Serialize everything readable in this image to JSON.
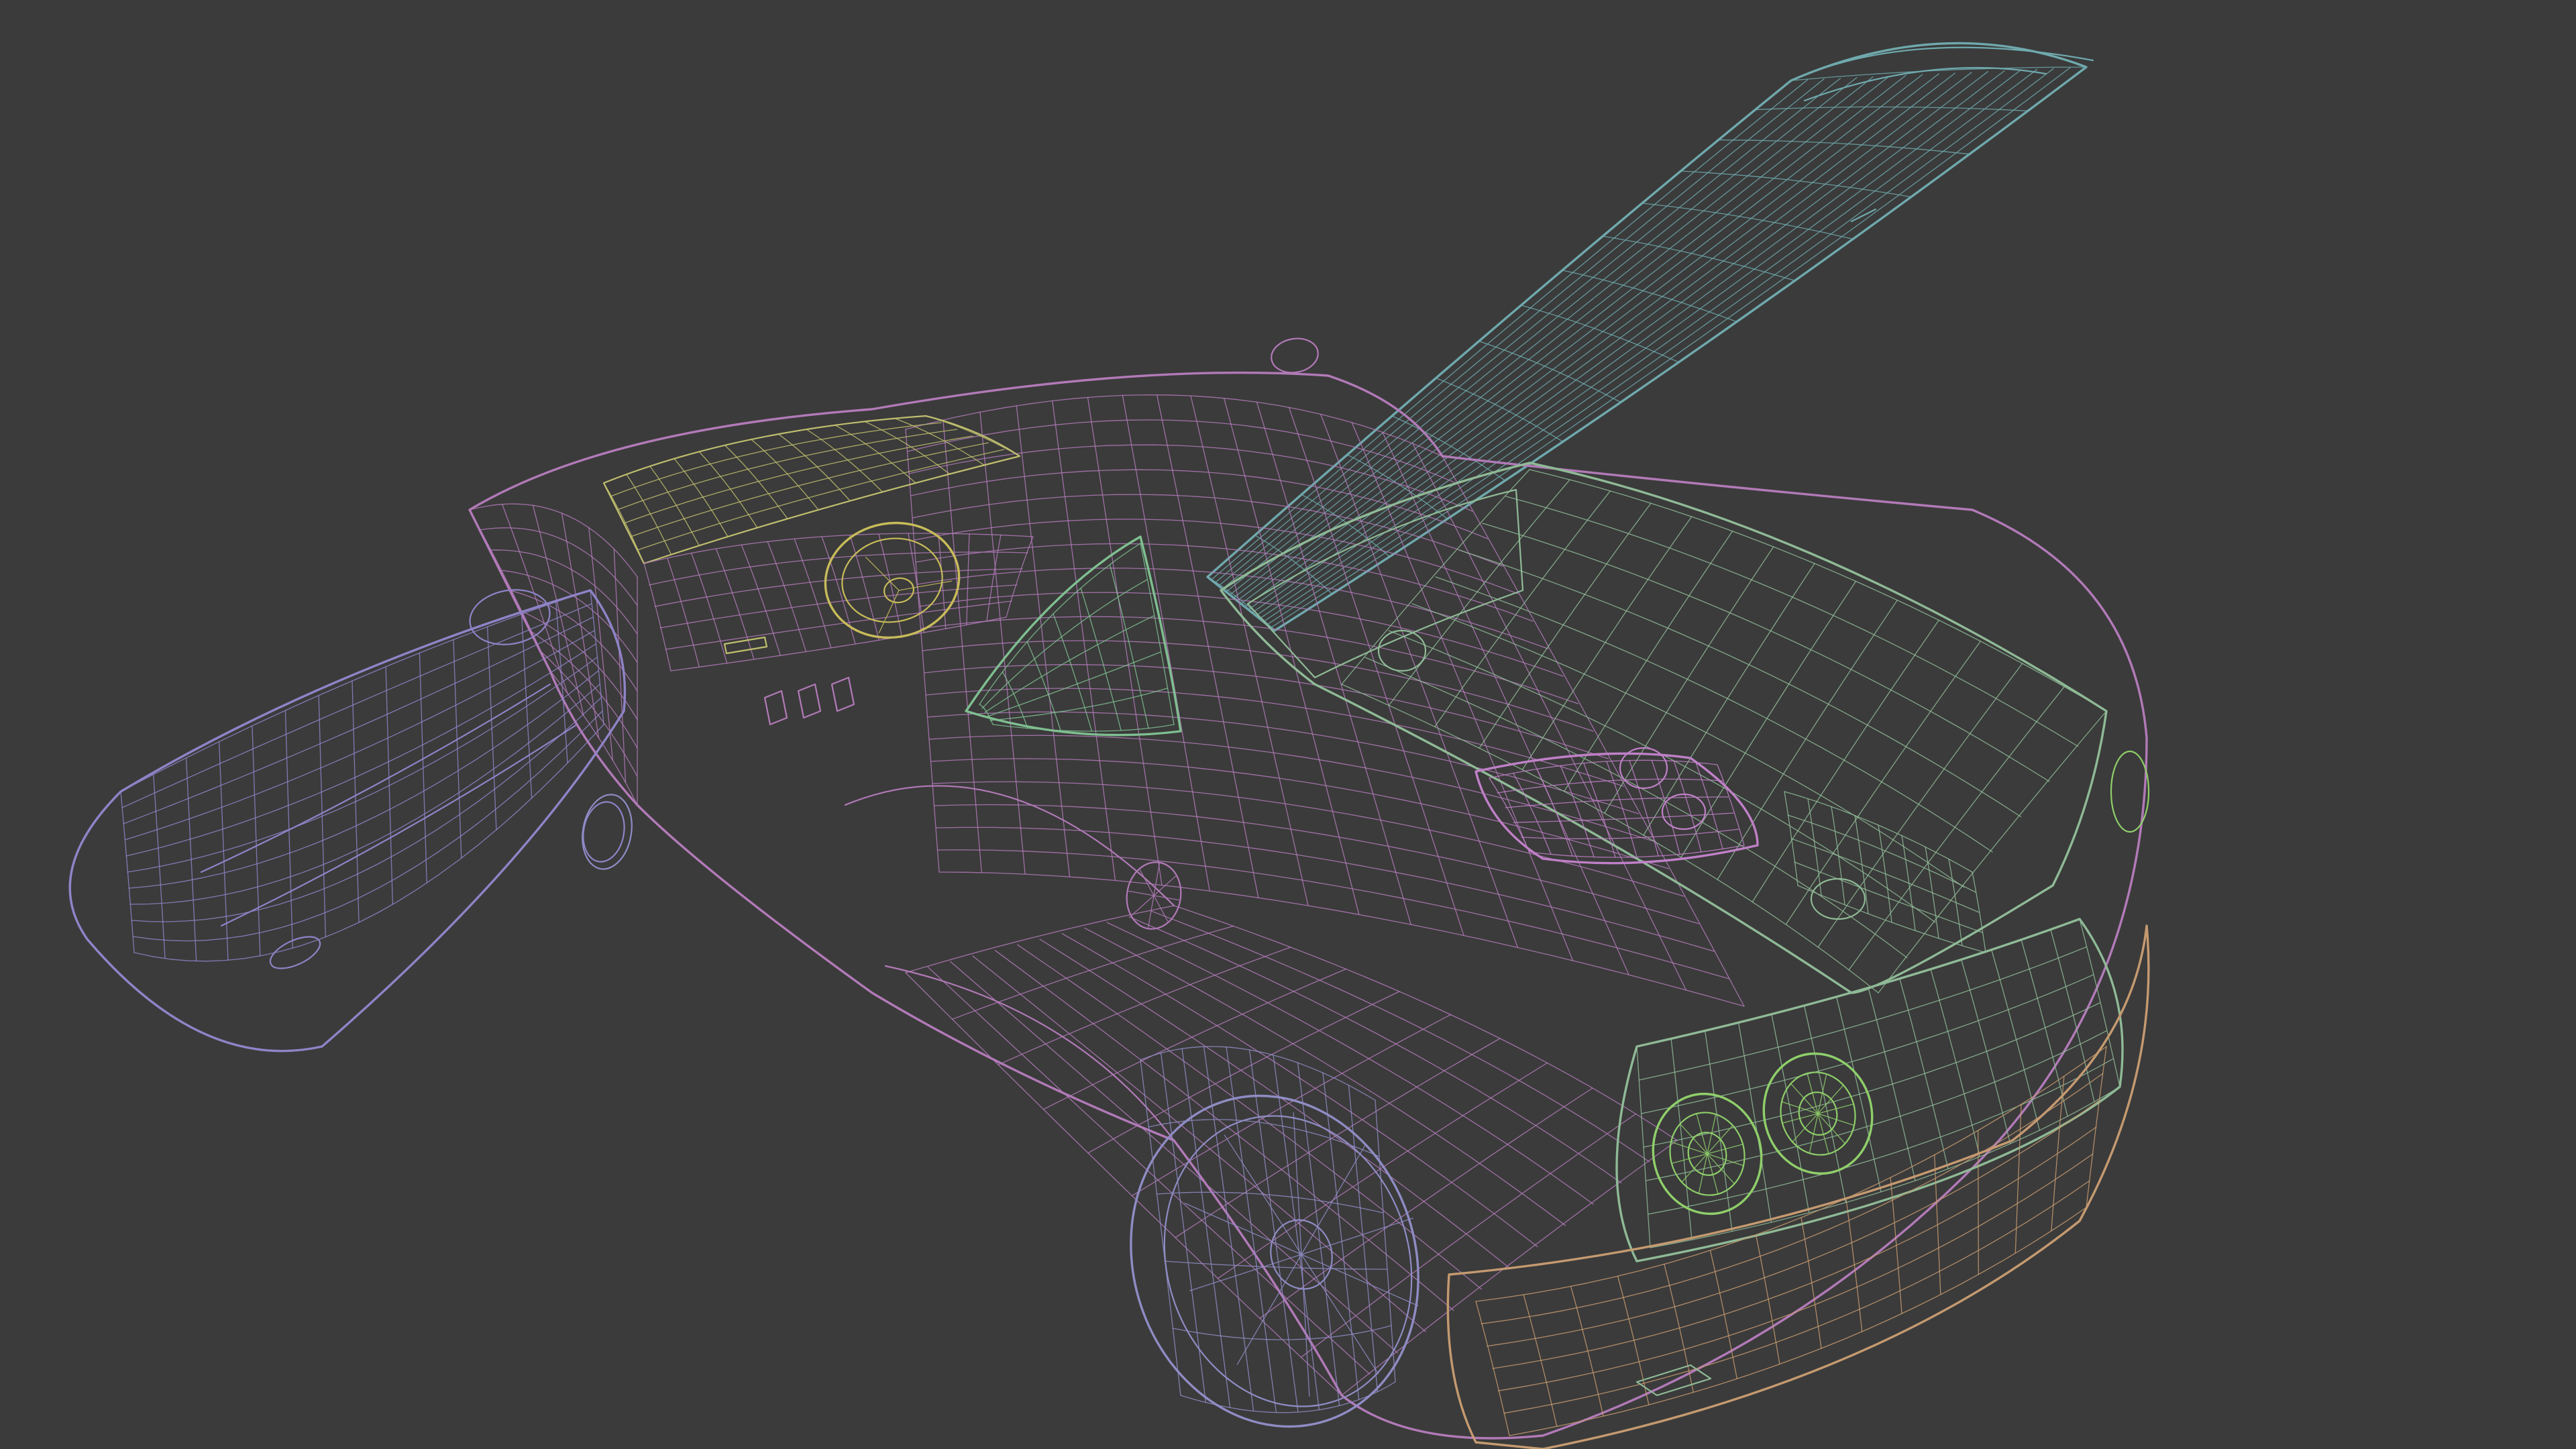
{
  "scene": {
    "background": "#3b3b3b",
    "render_mode": "wireframe",
    "subject": "car"
  },
  "wire_colors": {
    "body": "#b27ab8",
    "door": "#8f84c8",
    "hood": "#6fa9ad",
    "engine_bay": "#8fba96",
    "rear_bumper": "#c59a70",
    "windshield": "#bfbe6e",
    "steering": "#c8bc5a",
    "wheel": "#8f8cc4",
    "engine": "#c080c8",
    "taillight": "#8fcf6a",
    "window_frame": "#7fbf90"
  },
  "icons": {
    "car": "car-wireframe",
    "wheel": "wheel-icon",
    "steering": "steering-wheel-icon"
  }
}
